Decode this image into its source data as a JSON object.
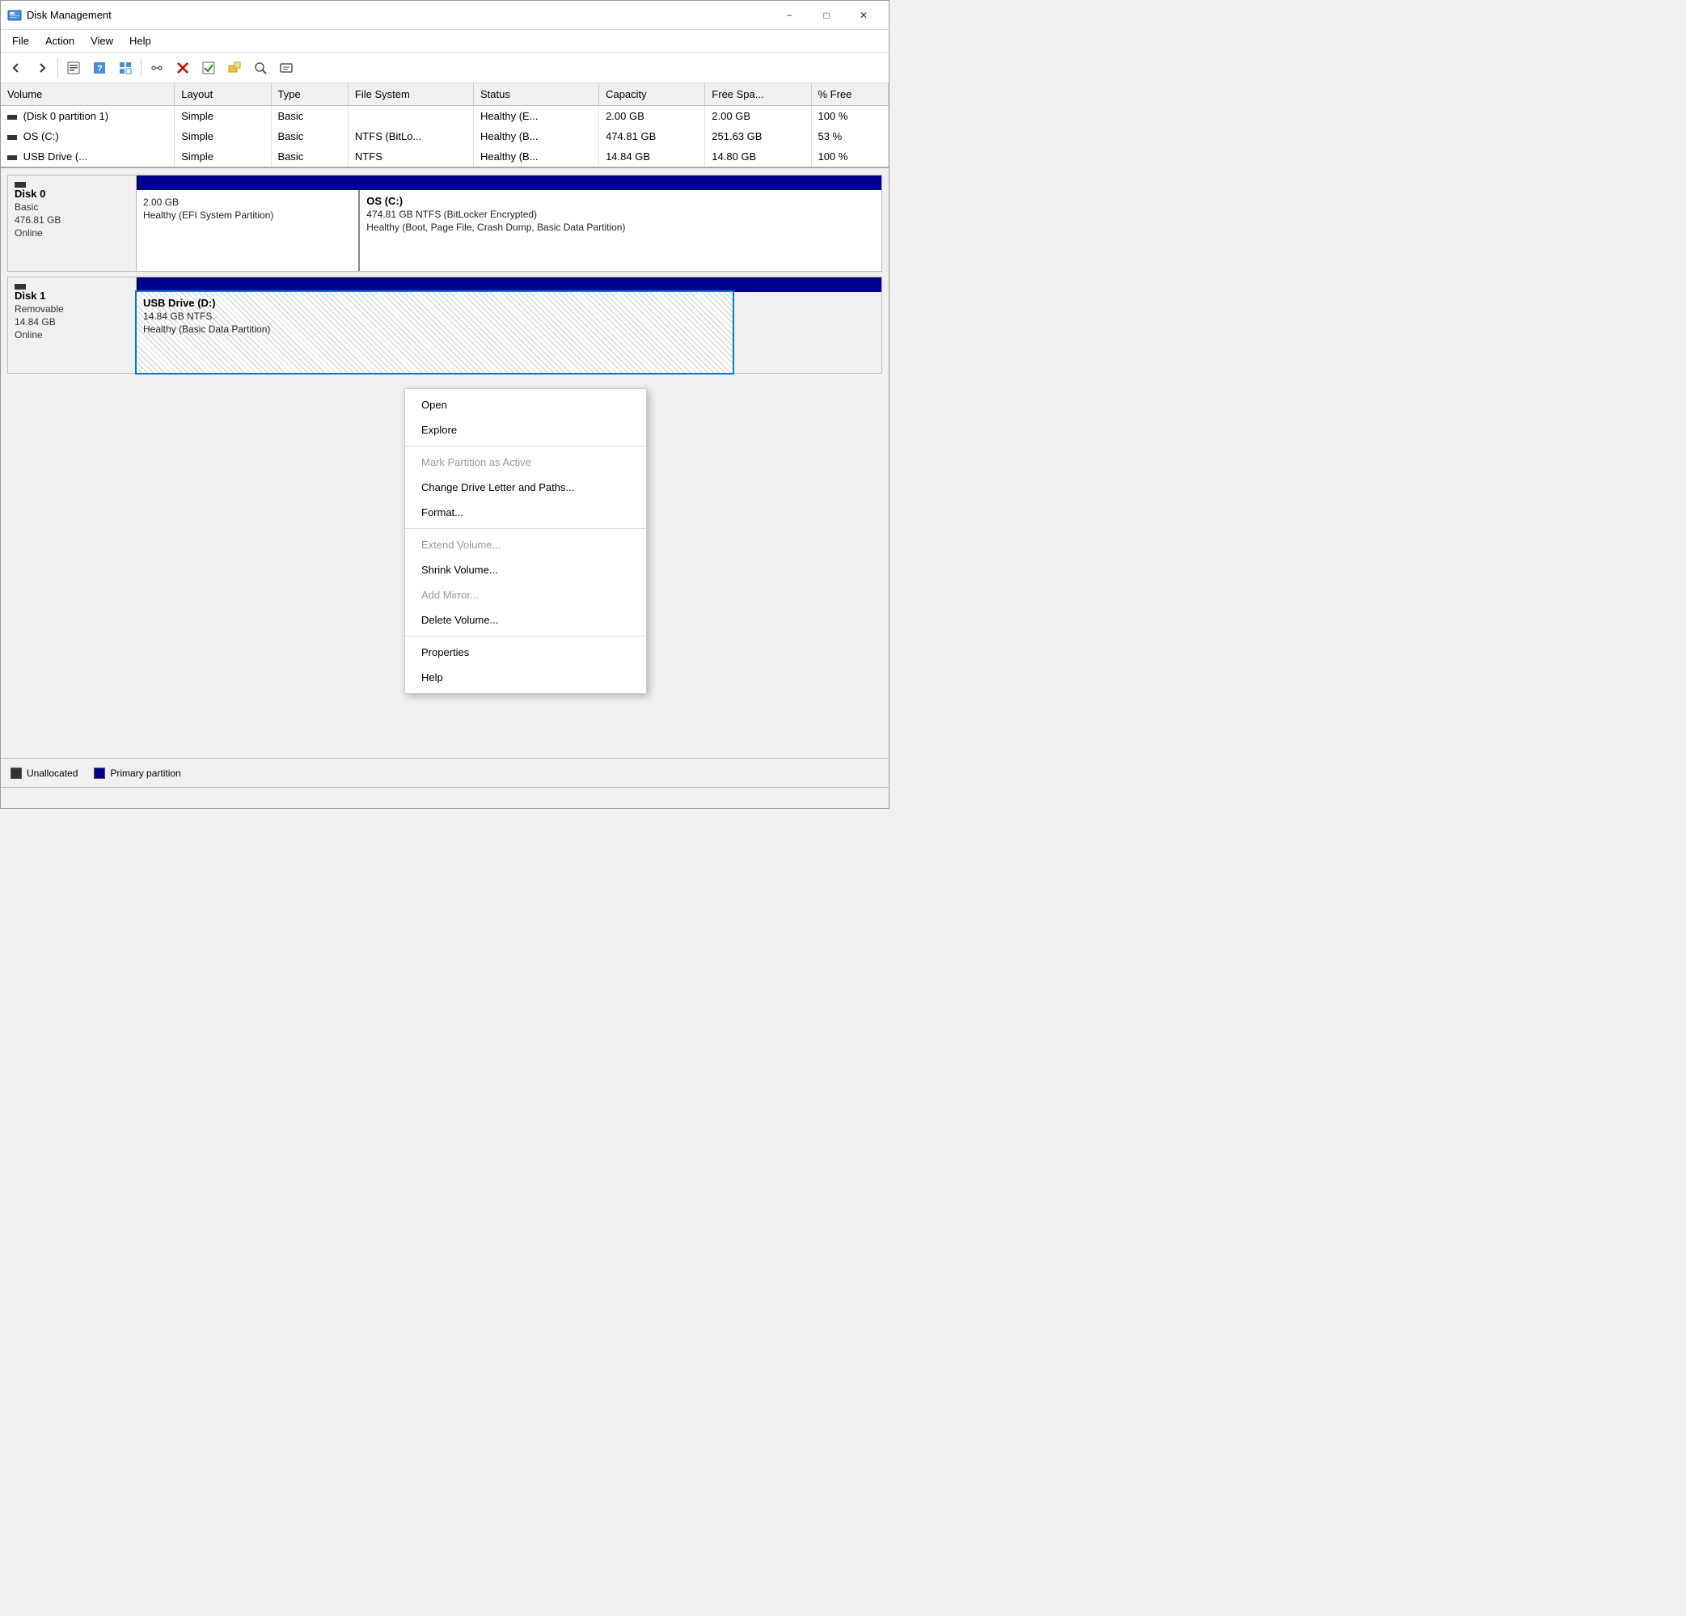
{
  "window": {
    "title": "Disk Management",
    "min_btn": "−",
    "max_btn": "□",
    "close_btn": "✕"
  },
  "menu": {
    "items": [
      "File",
      "Action",
      "View",
      "Help"
    ]
  },
  "toolbar": {
    "buttons": [
      {
        "name": "back",
        "icon": "◀"
      },
      {
        "name": "forward",
        "icon": "▶"
      },
      {
        "name": "properties",
        "icon": "⊞"
      },
      {
        "name": "help",
        "icon": "?"
      },
      {
        "name": "describe",
        "icon": "▦"
      },
      {
        "name": "connect",
        "icon": "↷"
      },
      {
        "name": "delete",
        "icon": "✖"
      },
      {
        "name": "check",
        "icon": "✓"
      },
      {
        "name": "add",
        "icon": "⬛"
      },
      {
        "name": "find",
        "icon": "🔍"
      },
      {
        "name": "export",
        "icon": "⊟"
      }
    ]
  },
  "table": {
    "columns": [
      "Volume",
      "Layout",
      "Type",
      "File System",
      "Status",
      "Capacity",
      "Free Spa...",
      "% Free"
    ],
    "rows": [
      {
        "volume": "(Disk 0 partition 1)",
        "layout": "Simple",
        "type": "Basic",
        "filesystem": "",
        "status": "Healthy (E...",
        "capacity": "2.00 GB",
        "free": "2.00 GB",
        "pct_free": "100 %"
      },
      {
        "volume": "OS (C:)",
        "layout": "Simple",
        "type": "Basic",
        "filesystem": "NTFS (BitLo...",
        "status": "Healthy (B...",
        "capacity": "474.81 GB",
        "free": "251.63 GB",
        "pct_free": "53 %"
      },
      {
        "volume": "USB Drive (...",
        "layout": "Simple",
        "type": "Basic",
        "filesystem": "NTFS",
        "status": "Healthy (B...",
        "capacity": "14.84 GB",
        "free": "14.80 GB",
        "pct_free": "100 %"
      }
    ]
  },
  "disks": [
    {
      "name": "Disk 0",
      "type": "Basic",
      "size": "476.81 GB",
      "status": "Online",
      "partitions": [
        {
          "label": "",
          "size": "2.00 GB",
          "detail": "Healthy (EFI System Partition)",
          "width_pct": 30,
          "type": "primary"
        },
        {
          "label": "OS  (C:)",
          "size": "474.81 GB NTFS (BitLocker Encrypted)",
          "detail": "Healthy (Boot, Page File, Crash Dump, Basic Data Partition)",
          "width_pct": 70,
          "type": "primary"
        }
      ]
    },
    {
      "name": "Disk 1",
      "type": "Removable",
      "size": "14.84 GB",
      "status": "Online",
      "partitions": [
        {
          "label": "USB Drive  (D:)",
          "size": "14.84 GB NTFS",
          "detail": "Healthy (Basic Data Partition)",
          "width_pct": 80,
          "type": "hatched selected"
        }
      ]
    }
  ],
  "legend": {
    "items": [
      {
        "type": "unallocated",
        "label": "Unallocated"
      },
      {
        "type": "primary",
        "label": "Primary partition"
      }
    ]
  },
  "context_menu": {
    "items": [
      {
        "label": "Open",
        "disabled": false,
        "separator_after": false
      },
      {
        "label": "Explore",
        "disabled": false,
        "separator_after": true
      },
      {
        "label": "Mark Partition as Active",
        "disabled": true,
        "separator_after": false
      },
      {
        "label": "Change Drive Letter and Paths...",
        "disabled": false,
        "separator_after": false
      },
      {
        "label": "Format...",
        "disabled": false,
        "separator_after": true
      },
      {
        "label": "Extend Volume...",
        "disabled": true,
        "separator_after": false
      },
      {
        "label": "Shrink Volume...",
        "disabled": false,
        "separator_after": false
      },
      {
        "label": "Add Mirror...",
        "disabled": true,
        "separator_after": false
      },
      {
        "label": "Delete Volume...",
        "disabled": false,
        "separator_after": true
      },
      {
        "label": "Properties",
        "disabled": false,
        "separator_after": false
      },
      {
        "label": "Help",
        "disabled": false,
        "separator_after": false
      }
    ]
  },
  "status_bar": {
    "text": ""
  }
}
